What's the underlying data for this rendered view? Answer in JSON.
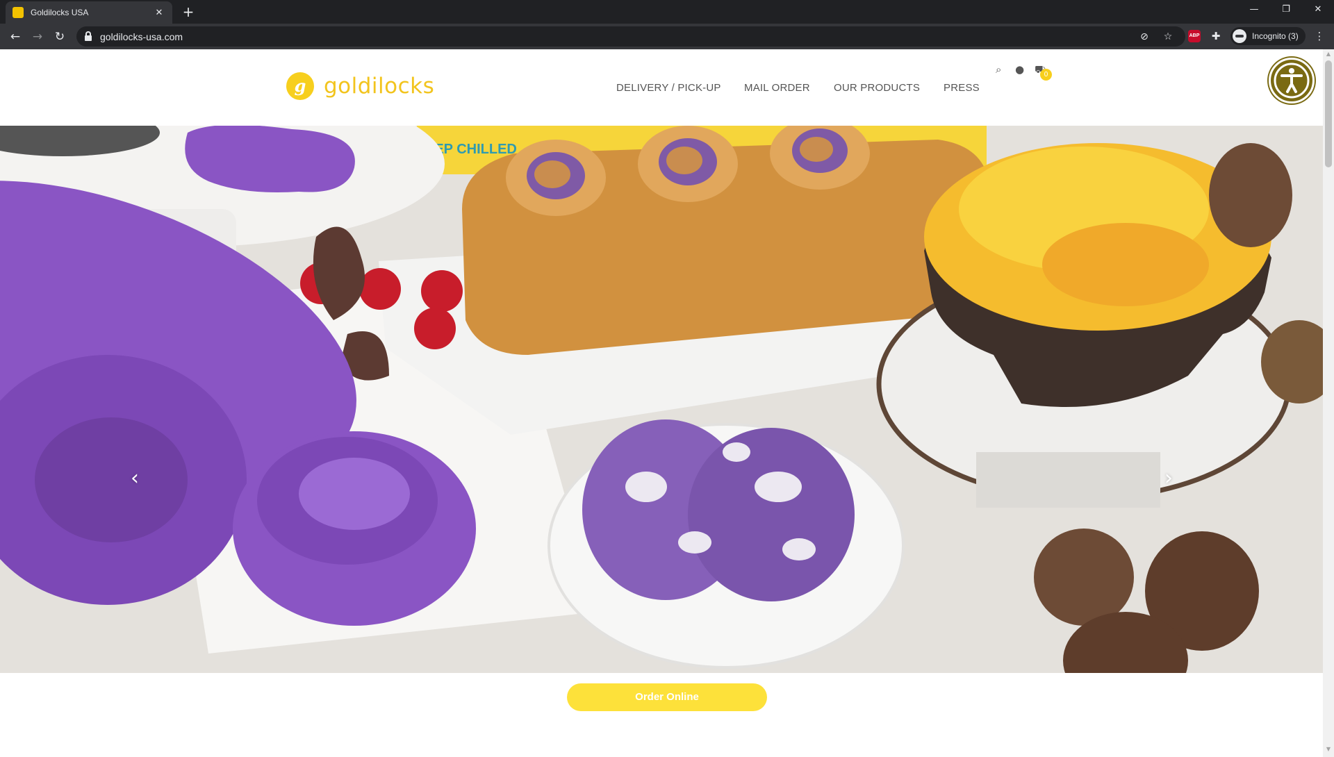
{
  "browser": {
    "tab_title": "Goldilocks USA",
    "tab_close": "✕",
    "new_tab": "+",
    "window_controls": {
      "minimize": "—",
      "restore": "❐",
      "close": "✕"
    },
    "nav": {
      "back": "←",
      "forward": "→",
      "reload": "↻"
    },
    "url": "goldilocks-usa.com",
    "incognito_label": "Incognito (3)",
    "abp_label": "ABP",
    "menu": "⋮"
  },
  "site": {
    "logo_mark": "g",
    "logo_text": "goldilocks",
    "nav": [
      {
        "label": "DELIVERY / PICK-UP"
      },
      {
        "label": "MAIL ORDER"
      },
      {
        "label": "OUR PRODUCTS"
      },
      {
        "label": "PRESS"
      }
    ],
    "cart_count": "0",
    "hero_banner_text": "EEP CHILLED",
    "carousel_prev": "‹",
    "carousel_next": "›",
    "order_button": "Order Online"
  },
  "colors": {
    "brand_yellow": "#f7cf1d",
    "button_yellow": "#fde13a",
    "ube_purple": "#8a55c4",
    "accessibility": "#7a6a12"
  }
}
